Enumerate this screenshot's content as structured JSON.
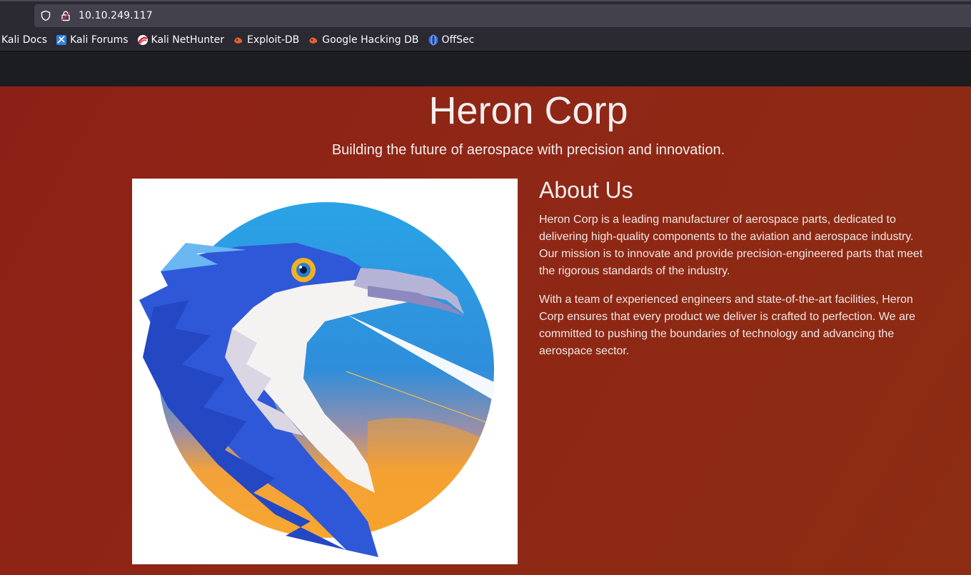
{
  "browser": {
    "url": "10.10.249.117",
    "bookmarks": [
      {
        "label": "Kali Docs",
        "icon": "kali-docs-icon"
      },
      {
        "label": "Kali Forums",
        "icon": "kali-forums-icon"
      },
      {
        "label": "Kali NetHunter",
        "icon": "kali-nethunter-icon"
      },
      {
        "label": "Exploit-DB",
        "icon": "exploit-db-icon"
      },
      {
        "label": "Google Hacking DB",
        "icon": "google-hacking-db-icon"
      },
      {
        "label": "OffSec",
        "icon": "offsec-icon"
      }
    ]
  },
  "site": {
    "title": "Heron Corp",
    "tagline": "Building the future of aerospace with precision and innovation.",
    "about": {
      "heading": "About Us",
      "paragraphs": [
        "Heron Corp is a leading manufacturer of aerospace parts, dedicated to delivering high-quality components to the aviation and aerospace industry. Our mission is to innovate and provide precision-engineered parts that meet the rigorous standards of the industry.",
        "With a team of experienced engineers and state-of-the-art facilities, Heron Corp ensures that every product we deliver is crafted to perfection. We are committed to pushing the boundaries of technology and advancing the aerospace sector."
      ]
    }
  },
  "colors": {
    "page_background": "#8d2016",
    "toolbar": "#2b2a33",
    "urlbar": "#42414d",
    "sky_blue": "#2a9fe3",
    "sunset_orange": "#f6a533",
    "heron_blue": "#2d55d6"
  }
}
